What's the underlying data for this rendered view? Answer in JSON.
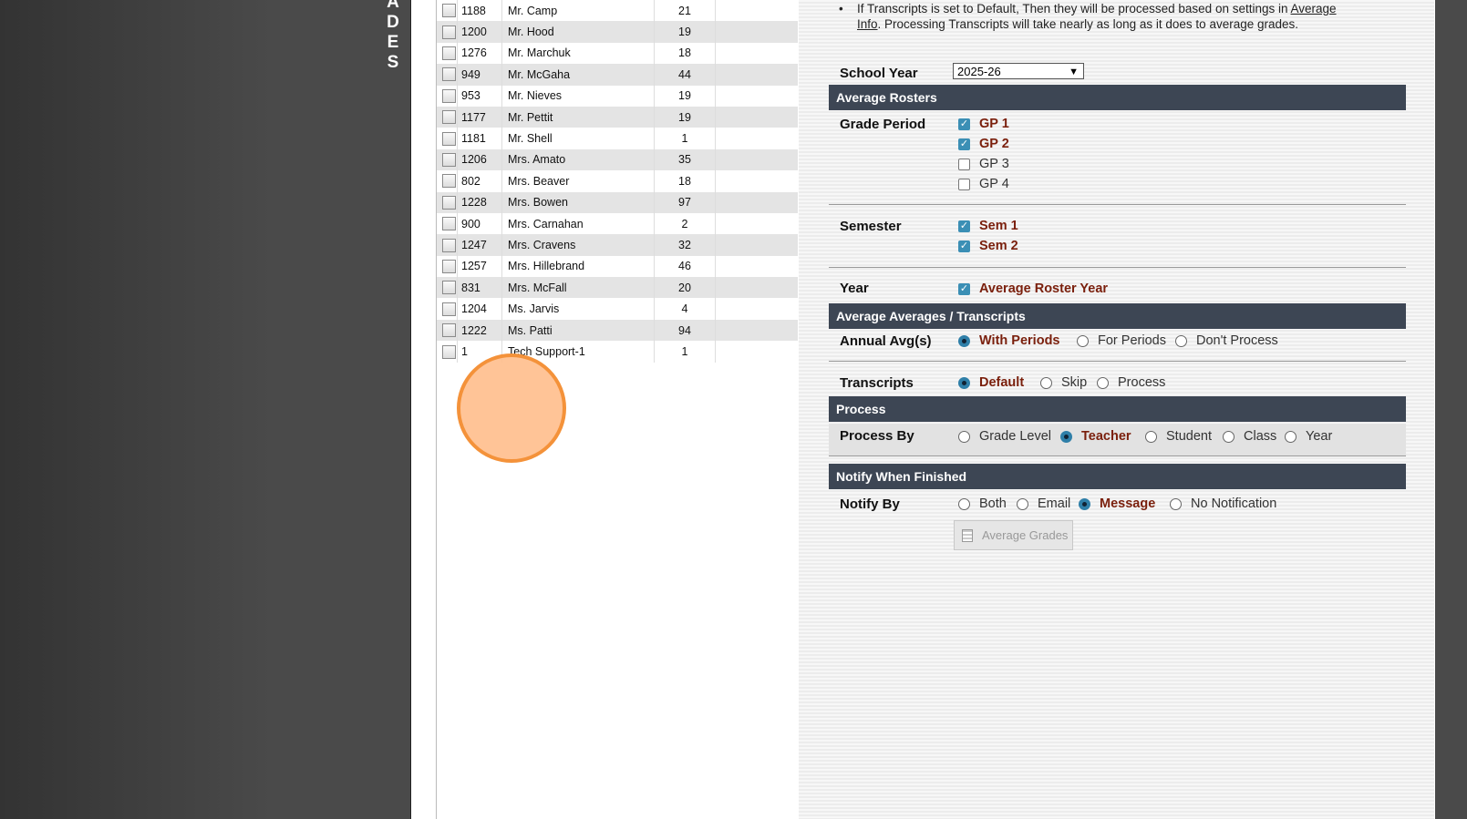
{
  "side_rail": {
    "letters": [
      "A",
      "D",
      "E",
      "S"
    ]
  },
  "teachers": [
    {
      "id": "1188",
      "name": "Mr. Camp",
      "count": "21"
    },
    {
      "id": "1200",
      "name": "Mr. Hood",
      "count": "19"
    },
    {
      "id": "1276",
      "name": "Mr. Marchuk",
      "count": "18"
    },
    {
      "id": "949",
      "name": "Mr. McGaha",
      "count": "44"
    },
    {
      "id": "953",
      "name": "Mr. Nieves",
      "count": "19"
    },
    {
      "id": "1177",
      "name": "Mr. Pettit",
      "count": "19"
    },
    {
      "id": "1181",
      "name": "Mr. Shell",
      "count": "1"
    },
    {
      "id": "1206",
      "name": "Mrs. Amato",
      "count": "35"
    },
    {
      "id": "802",
      "name": "Mrs. Beaver",
      "count": "18"
    },
    {
      "id": "1228",
      "name": "Mrs. Bowen",
      "count": "97"
    },
    {
      "id": "900",
      "name": "Mrs. Carnahan",
      "count": "2"
    },
    {
      "id": "1247",
      "name": "Mrs. Cravens",
      "count": "32"
    },
    {
      "id": "1257",
      "name": "Mrs. Hillebrand",
      "count": "46"
    },
    {
      "id": "831",
      "name": "Mrs. McFall",
      "count": "20"
    },
    {
      "id": "1204",
      "name": "Ms. Jarvis",
      "count": "4"
    },
    {
      "id": "1222",
      "name": "Ms. Patti",
      "count": "94"
    },
    {
      "id": "1",
      "name": "Tech Support-1",
      "count": "1"
    }
  ],
  "notes": {
    "line1": "If Transcripts is set to Default, Then they will be processed based on settings in",
    "link": "Average Info",
    "line2": ". Processing Transcripts will take nearly as long as it does to average grades."
  },
  "school_year": {
    "label": "School Year",
    "value": "2025-26"
  },
  "average_rosters": {
    "header": "Average Rosters",
    "grade_period": {
      "label": "Grade Period",
      "options": [
        {
          "label": "GP 1",
          "checked": true
        },
        {
          "label": "GP 2",
          "checked": true
        },
        {
          "label": "GP 3",
          "checked": false
        },
        {
          "label": "GP 4",
          "checked": false
        }
      ]
    },
    "semester": {
      "label": "Semester",
      "options": [
        {
          "label": "Sem 1",
          "checked": true
        },
        {
          "label": "Sem 2",
          "checked": true
        }
      ]
    },
    "year": {
      "label": "Year",
      "option": "Average Roster Year",
      "checked": true
    }
  },
  "average_averages": {
    "header": "Average Averages / Transcripts",
    "annual": {
      "label": "Annual Avg(s)",
      "options": [
        "With Periods",
        "For Periods",
        "Don't Process"
      ],
      "selected": "With Periods"
    },
    "transcripts": {
      "label": "Transcripts",
      "options": [
        "Default",
        "Skip",
        "Process"
      ],
      "selected": "Default"
    }
  },
  "process": {
    "header": "Process",
    "label": "Process By",
    "options": [
      "Grade Level",
      "Teacher",
      "Student",
      "Class",
      "Year"
    ],
    "selected": "Teacher"
  },
  "notify": {
    "header": "Notify When Finished",
    "label": "Notify By",
    "options": [
      "Both",
      "Email",
      "Message",
      "No Notification"
    ],
    "selected": "Message"
  },
  "button": {
    "label": "Average Grades"
  },
  "colors": {
    "section_bar": "#3d4654",
    "selected_text": "#7a1f0c",
    "check_blue": "#3b8fb5",
    "cursor": "#f4923a"
  }
}
